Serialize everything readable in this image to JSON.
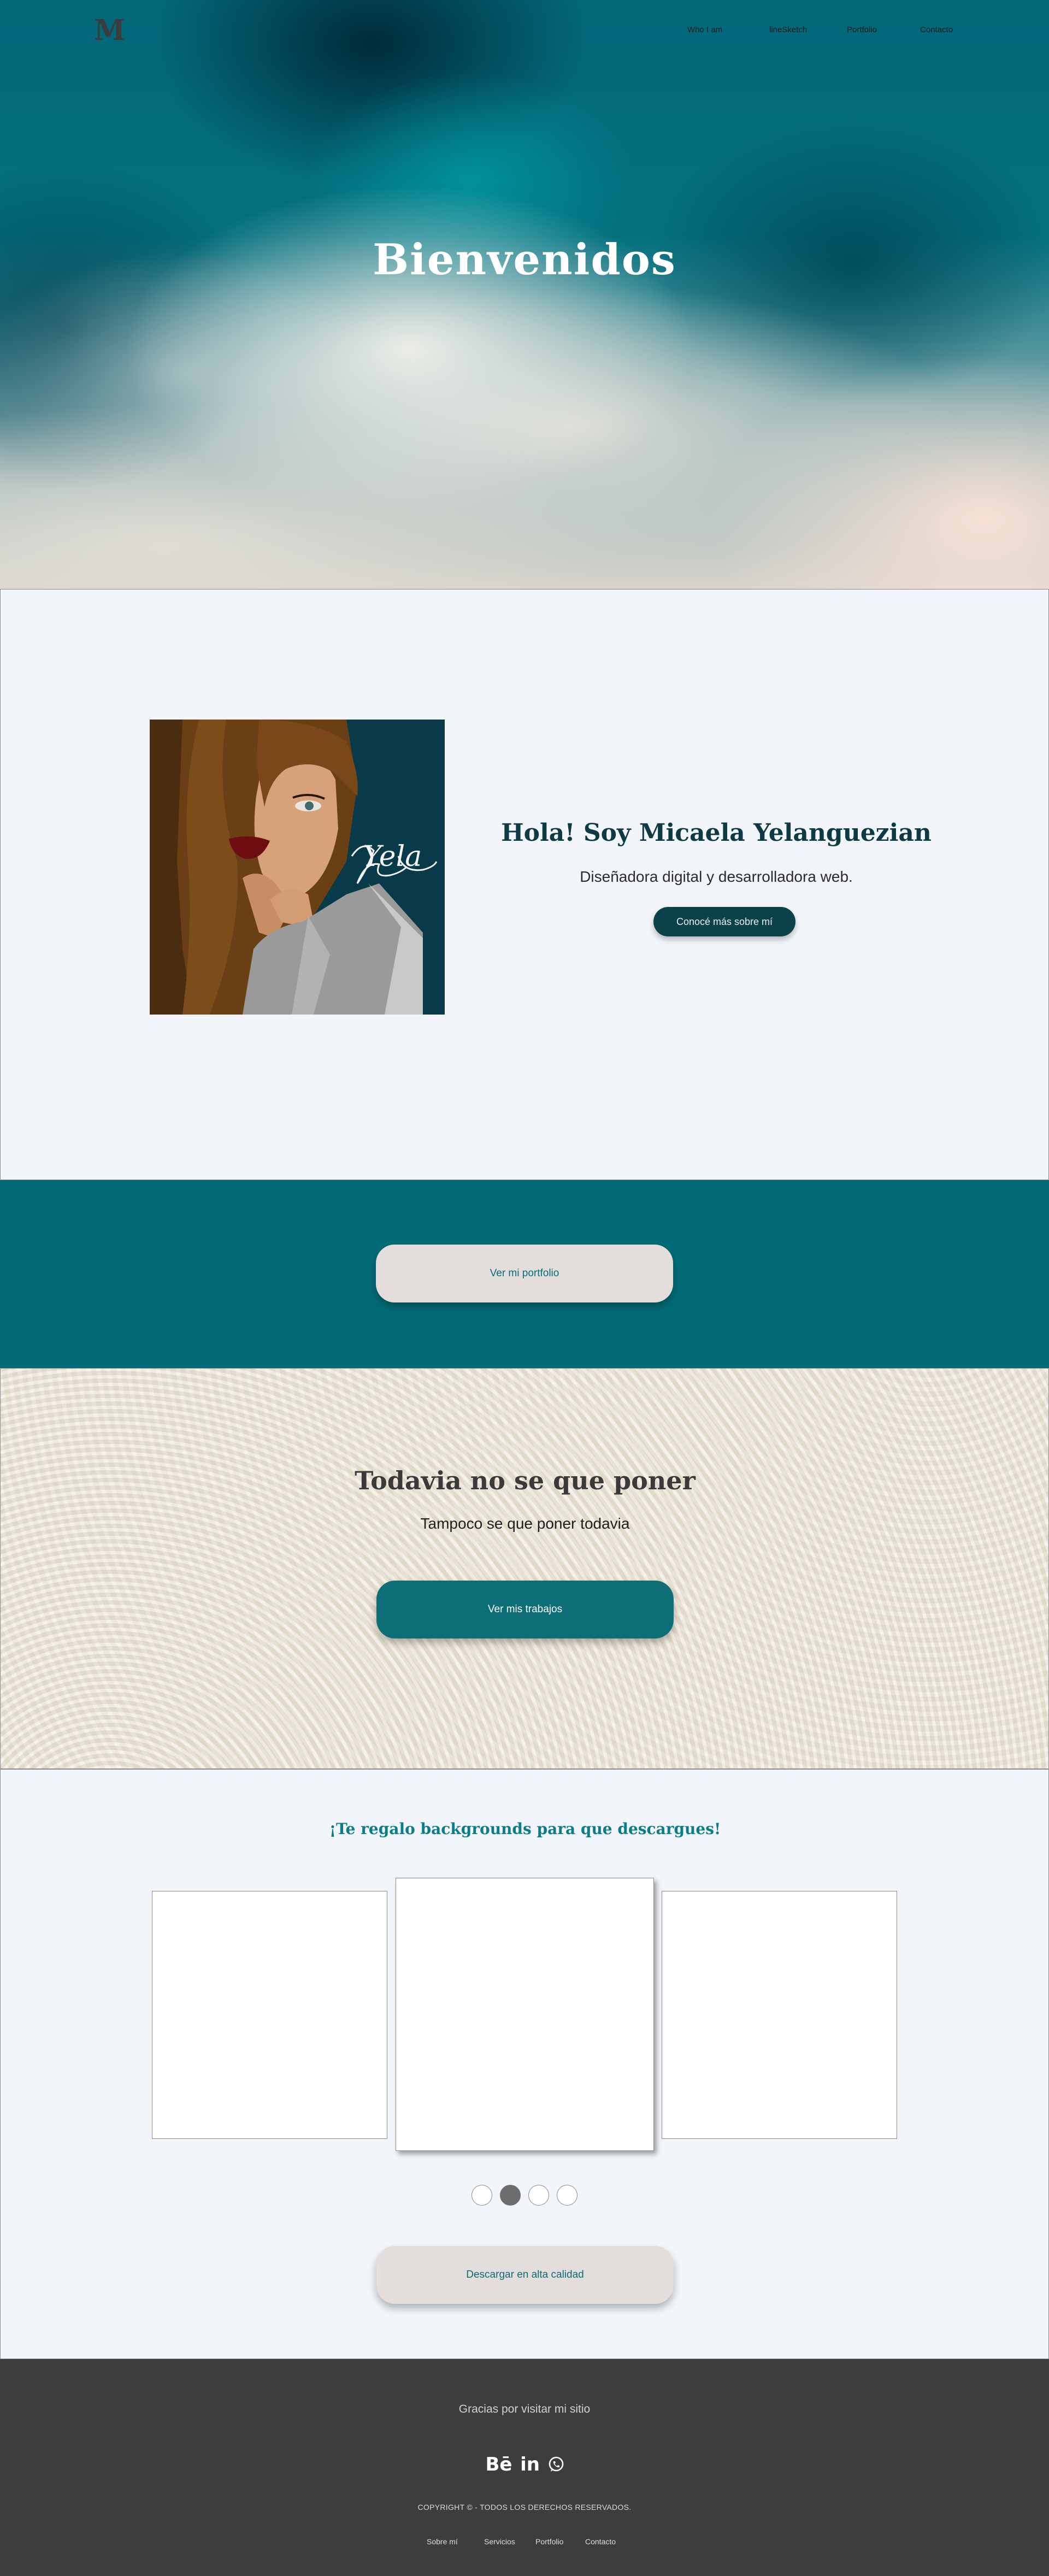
{
  "header": {
    "logo": "M",
    "nav": [
      "Who I am",
      "lineSketch",
      "Portfolio",
      "Contacto"
    ]
  },
  "hero": {
    "title": "Bienvenidos"
  },
  "about": {
    "signature": "Yela",
    "title": "Hola! Soy Micaela Yelanguezian",
    "subtitle": "Diseñadora digital y desarrolladora web.",
    "button": "Conocé más sobre mí"
  },
  "portfolio_band": {
    "button": "Ver mi portfolio"
  },
  "texture_section": {
    "title": "Todavia no se que poner",
    "subtitle": "Tampoco se que poner todavia",
    "button": "Ver mis trabajos"
  },
  "backgrounds": {
    "title": "¡Te regalo backgrounds para que descargues!",
    "slide_count": 4,
    "active_dot": 2,
    "download_button": "Descargar en alta calidad"
  },
  "footer": {
    "thanks": "Gracias por visitar mi sitio",
    "social_icons": [
      "behance-icon",
      "linkedin-icon",
      "whatsapp-icon"
    ],
    "behance_glyph": "Bē",
    "linkedin_glyph": "in",
    "copyright": "COPYRIGHT ©  - TODOS LOS DERECHOS RESERVADOS.",
    "links": [
      "Sobre mí",
      "Servicios",
      "Portfolio",
      "Contacto"
    ]
  },
  "colors": {
    "teal_dark": "#0b4149",
    "teal_band": "#036b76",
    "teal_text": "#0b7d87",
    "beige_button": "#e3dedb",
    "footer_bg": "#3d3d40",
    "page_bg": "#f2f5fa"
  }
}
